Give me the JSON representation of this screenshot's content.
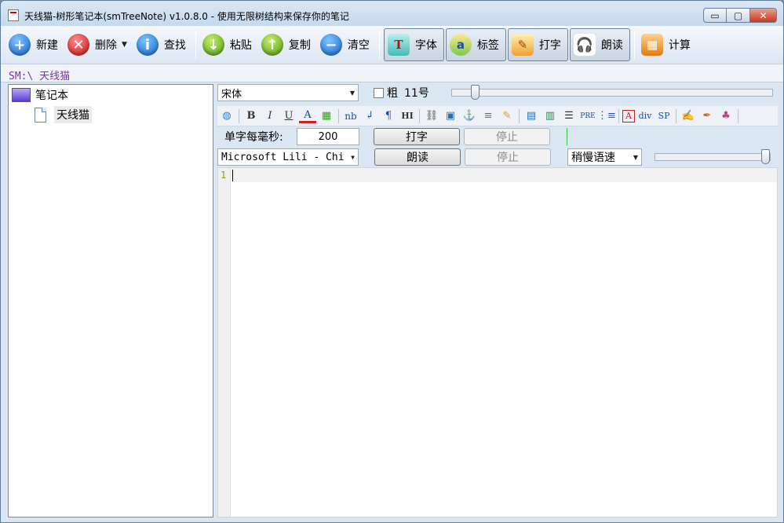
{
  "window": {
    "title": "天线猫-树形笔记本(smTreeNote) v1.0.8.0 - 使用无限树结构来保存你的笔记",
    "controls": {
      "minimize": "▭",
      "maximize": "▢",
      "close": "✕"
    }
  },
  "toolbar": {
    "new_label": "新建",
    "delete_label": "删除",
    "find_label": "查找",
    "paste_label": "粘贴",
    "copy_label": "复制",
    "clear_label": "清空",
    "font_label": "字体",
    "tag_label": "标签",
    "type_label": "打字",
    "read_label": "朗读",
    "calc_label": "计算"
  },
  "path": "SM:\\ 天线猫",
  "tree": {
    "root_label": "笔记本",
    "child_label": "天线猫"
  },
  "font_row": {
    "font_name": "宋体",
    "bold_label": "粗",
    "size_label": "11号",
    "slider_value": 0.06
  },
  "format_icons": [
    "globe-icon",
    "bold-icon",
    "italic-icon",
    "underline-icon",
    "font-color-icon",
    "color-grid-icon",
    "nbsp-icon",
    "line-break-icon",
    "paragraph-icon",
    "heading-icon",
    "link-icon",
    "image-icon",
    "anchor-icon",
    "hr-icon",
    "highlight-icon",
    "table-icon",
    "list-box-icon",
    "align-icon",
    "pre-icon",
    "ordered-list-icon",
    "pdf-icon",
    "div-icon",
    "sp-icon",
    "edit-icon",
    "pen-icon",
    "paint-icon"
  ],
  "format_glyphs": {
    "bold": "B",
    "italic": "I",
    "underline": "U",
    "nb": "nb",
    "pre": "PRE",
    "div": "div",
    "sp": "SP",
    "heading": "HI",
    "paragraph": "¶",
    "line_break": "↲"
  },
  "typing_row": {
    "ms_label": "单字每毫秒:",
    "ms_value": "200",
    "type_button": "打字",
    "stop_button": "停止"
  },
  "read_row": {
    "voice": "Microsoft Lili - Chi",
    "read_button": "朗读",
    "stop_button": "停止",
    "speed": "稍慢语速",
    "speed_slider_value": 1.0
  },
  "editor": {
    "line_number": "1"
  },
  "colors": {
    "path_text": "#7b2fbf",
    "accent_blue": "#1065c8"
  }
}
